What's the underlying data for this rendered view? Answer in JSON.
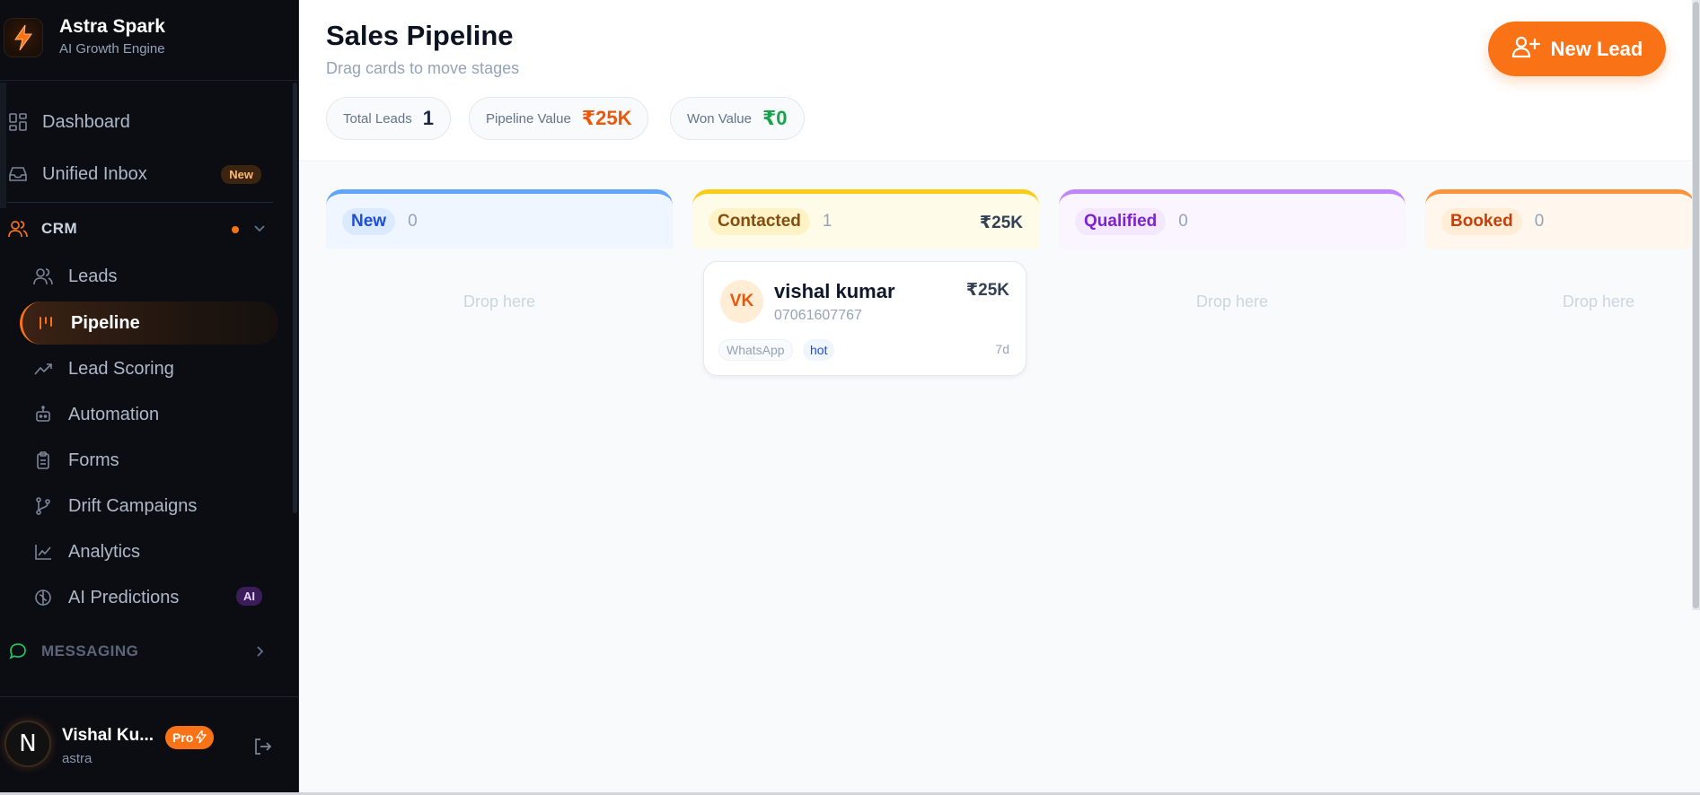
{
  "brand": {
    "name": "Astra Spark",
    "subtitle": "AI Growth Engine"
  },
  "sidebar": {
    "top_items": [
      {
        "label": "Dashboard",
        "icon": "dashboard-icon"
      },
      {
        "label": "Unified Inbox",
        "icon": "inbox-icon",
        "badge": "New"
      }
    ],
    "crm": {
      "label": "CRM",
      "icon": "users-icon",
      "items": [
        {
          "label": "Leads",
          "icon": "users-icon"
        },
        {
          "label": "Pipeline",
          "icon": "pipeline-icon",
          "active": true
        },
        {
          "label": "Lead Scoring",
          "icon": "trending-up-icon"
        },
        {
          "label": "Automation",
          "icon": "bot-icon"
        },
        {
          "label": "Forms",
          "icon": "clipboard-icon"
        },
        {
          "label": "Drift Campaigns",
          "icon": "git-branch-icon"
        },
        {
          "label": "Analytics",
          "icon": "line-chart-icon"
        },
        {
          "label": "AI Predictions",
          "icon": "brain-icon",
          "badge": "AI"
        }
      ]
    },
    "messaging": {
      "label": "MESSAGING",
      "icon": "chat-icon"
    }
  },
  "user": {
    "initial": "N",
    "name": "Vishal Ku...",
    "handle": "astra",
    "plan": "Pro"
  },
  "header": {
    "title": "Sales Pipeline",
    "subtitle": "Drag cards to move stages",
    "new_lead_label": "New Lead",
    "stats": [
      {
        "label": "Total Leads",
        "value": "1",
        "color": "#1e293b"
      },
      {
        "label": "Pipeline Value",
        "value": "₹25K",
        "color": "#ea580c"
      },
      {
        "label": "Won Value",
        "value": "₹0",
        "color": "#16a34a"
      }
    ]
  },
  "columns": [
    {
      "name": "New",
      "count": "0",
      "value": "",
      "drop": "Drop here",
      "accent": "#60a5fa",
      "bg": "#eff6ff",
      "pill_bg": "#dbeafe",
      "pill_fg": "#1d4ed8"
    },
    {
      "name": "Contacted",
      "count": "1",
      "value": "₹25K",
      "drop": "",
      "accent": "#facc15",
      "bg": "#fefce8",
      "pill_bg": "#fef3c7",
      "pill_fg": "#854d0e"
    },
    {
      "name": "Qualified",
      "count": "0",
      "value": "",
      "drop": "Drop here",
      "accent": "#c084fc",
      "bg": "#faf5ff",
      "pill_bg": "#f3e8ff",
      "pill_fg": "#7e22ce"
    },
    {
      "name": "Booked",
      "count": "0",
      "value": "",
      "drop": "Drop here",
      "accent": "#fb923c",
      "bg": "#fff7ed",
      "pill_bg": "#ffedd5",
      "pill_fg": "#c2410c"
    }
  ],
  "lead_card": {
    "initials": "VK",
    "name": "vishal kumar",
    "phone": "07061607767",
    "value": "₹25K",
    "source": "WhatsApp",
    "temperature": "hot",
    "age": "7d"
  }
}
